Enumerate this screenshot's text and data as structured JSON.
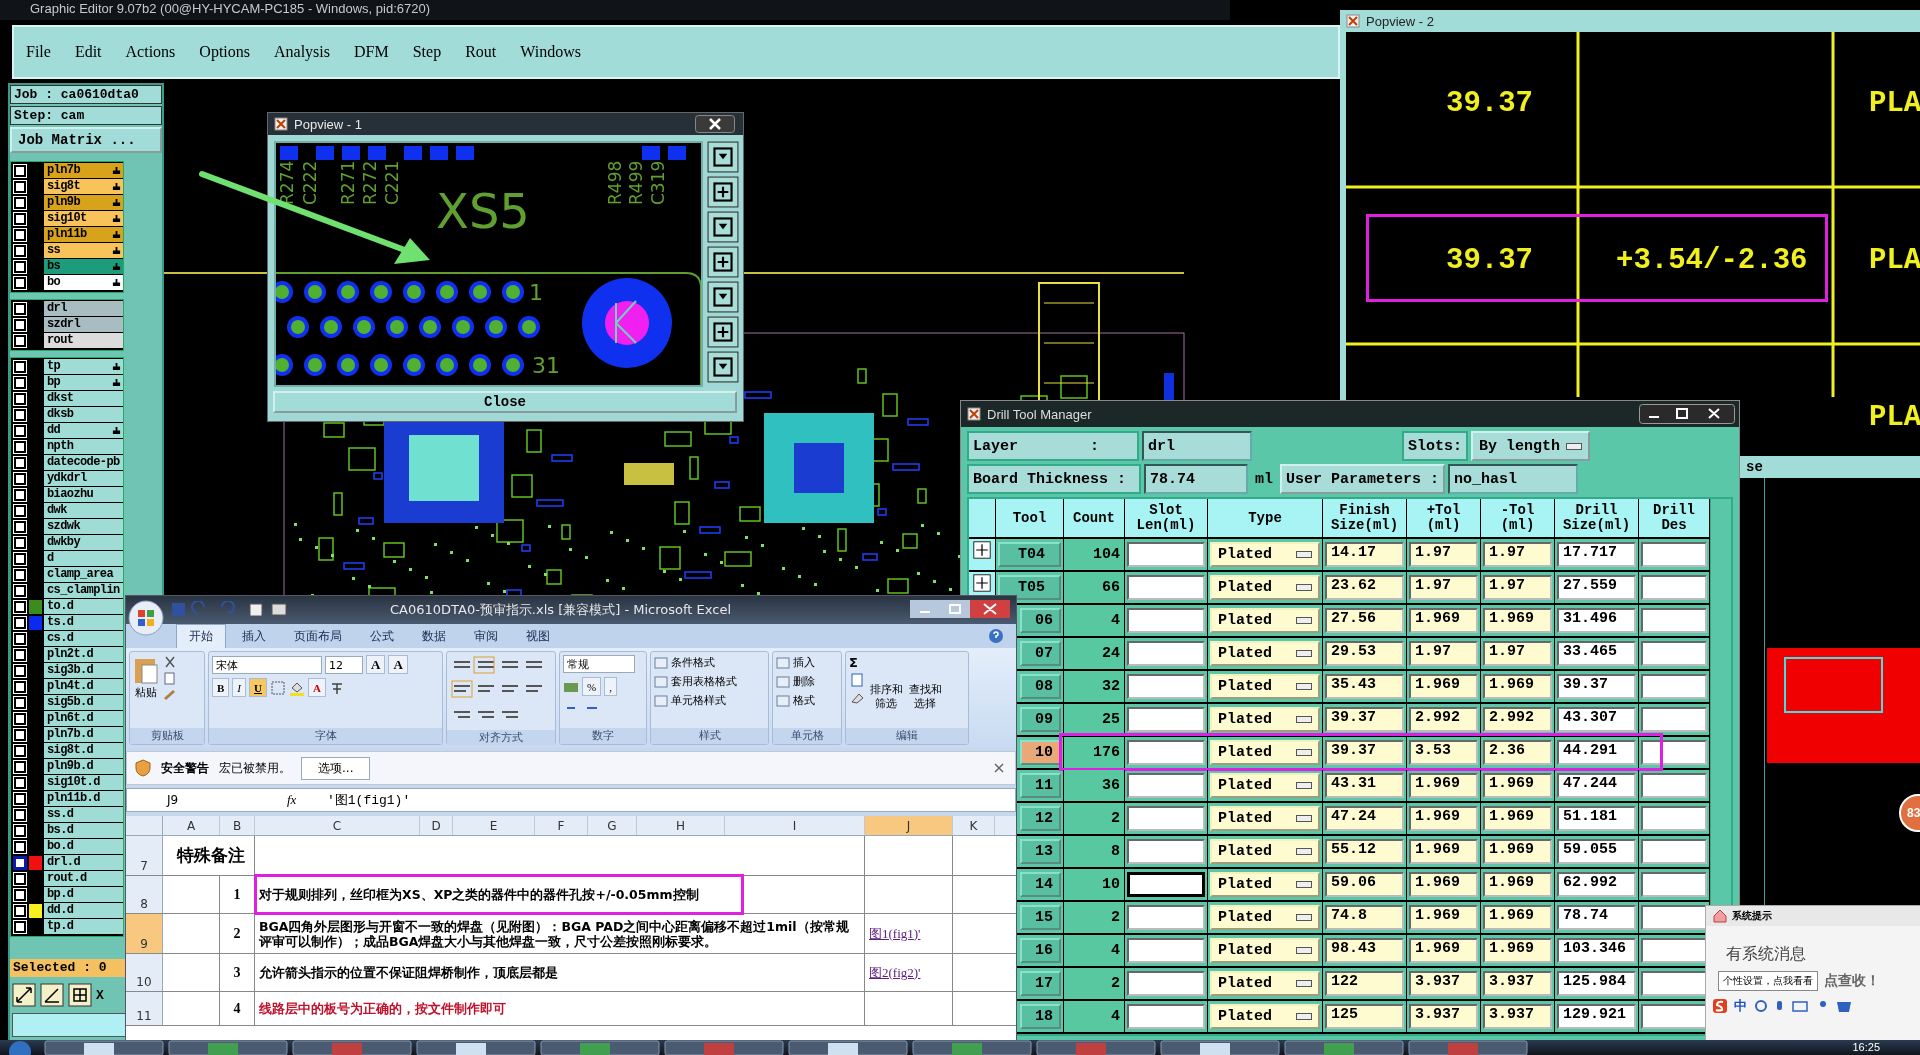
{
  "main_window": {
    "title": "Graphic Editor 9.07b2 (00@HY-HYCAM-PC185 - Windows, pid:6720)",
    "menu": [
      "File",
      "Edit",
      "Actions",
      "Options",
      "Analysis",
      "DFM",
      "Step",
      "Rout",
      "Windows"
    ]
  },
  "layer_panel": {
    "job": "Job : ca0610dta0",
    "step": "Step: cam",
    "matrix_button": "Job Matrix ...",
    "groups": [
      {
        "items": [
          {
            "name": "pln7b",
            "color": "#d9a21b",
            "pointer": true,
            "checked": false
          },
          {
            "name": "sig8t",
            "color": "#f7c35a",
            "pointer": true,
            "checked": false
          },
          {
            "name": "pln9b",
            "color": "#d9a21b",
            "pointer": true,
            "checked": false
          },
          {
            "name": "sig10t",
            "color": "#f7c35a",
            "pointer": true,
            "checked": false
          },
          {
            "name": "pln11b",
            "color": "#d9a21b",
            "pointer": true,
            "checked": false
          },
          {
            "name": "ss",
            "color": "#f7c35a",
            "pointer": true,
            "checked": false
          },
          {
            "name": "bs",
            "color": "#1d9c7c",
            "pointer": true,
            "checked": false
          },
          {
            "name": "bo",
            "color": "#ffffff",
            "pointer": true,
            "checked": false
          }
        ]
      },
      {
        "items": [
          {
            "name": "drl",
            "color": "#a9bcc2",
            "pointer": false,
            "checked": false
          },
          {
            "name": "szdrl",
            "color": "#a9bcc2",
            "pointer": false,
            "checked": false
          },
          {
            "name": "rout",
            "color": "#dcdcdc",
            "pointer": false,
            "checked": false
          }
        ]
      },
      {
        "items": [
          {
            "name": "tp",
            "color": "#9fdcd6",
            "pointer": true,
            "checked": false
          },
          {
            "name": "bp",
            "color": "#9fdcd6",
            "pointer": true,
            "checked": false
          },
          {
            "name": "dkst",
            "color": "#9fdcd6",
            "pointer": false,
            "checked": false
          },
          {
            "name": "dksb",
            "color": "#9fdcd6",
            "pointer": false,
            "checked": false
          },
          {
            "name": "dd",
            "color": "#9fdcd6",
            "pointer": true,
            "checked": false
          },
          {
            "name": "npth",
            "color": "#9fdcd6",
            "pointer": false,
            "checked": false
          },
          {
            "name": "datecode-pb",
            "color": "#9fdcd6",
            "pointer": false,
            "checked": false
          },
          {
            "name": "ydkdrl",
            "color": "#9fdcd6",
            "pointer": false,
            "checked": false
          },
          {
            "name": "biaozhu",
            "color": "#9fdcd6",
            "pointer": false,
            "checked": false
          },
          {
            "name": "dwk",
            "color": "#9fdcd6",
            "pointer": false,
            "checked": false
          },
          {
            "name": "szdwk",
            "color": "#9fdcd6",
            "pointer": false,
            "checked": false
          },
          {
            "name": "dwkby",
            "color": "#9fdcd6",
            "pointer": false,
            "checked": false
          },
          {
            "name": "d",
            "color": "#9fdcd6",
            "pointer": false,
            "checked": false
          },
          {
            "name": "clamp_area",
            "color": "#9fdcd6",
            "pointer": false,
            "checked": false
          },
          {
            "name": "cs_clamplin",
            "color": "#9fdcd6",
            "pointer": false,
            "checked": false
          },
          {
            "name": "to.d",
            "color": "#9fdcd6",
            "pointer": false,
            "checked": false,
            "swatch": {
              "color": "#3c8c1c"
            }
          },
          {
            "name": "ts.d",
            "color": "#9fdcd6",
            "pointer": false,
            "checked": false,
            "swatch": {
              "color": "#0a2af0"
            }
          },
          {
            "name": "cs.d",
            "color": "#9fdcd6",
            "pointer": false,
            "checked": false
          },
          {
            "name": "pln2t.d",
            "color": "#9fdcd6",
            "pointer": false,
            "checked": false
          },
          {
            "name": "sig3b.d",
            "color": "#9fdcd6",
            "pointer": false,
            "checked": false
          },
          {
            "name": "pln4t.d",
            "color": "#9fdcd6",
            "pointer": false,
            "checked": false
          },
          {
            "name": "sig5b.d",
            "color": "#9fdcd6",
            "pointer": false,
            "checked": false
          },
          {
            "name": "pln6t.d",
            "color": "#9fdcd6",
            "pointer": false,
            "checked": false
          },
          {
            "name": "pln7b.d",
            "color": "#9fdcd6",
            "pointer": false,
            "checked": false
          },
          {
            "name": "sig8t.d",
            "color": "#9fdcd6",
            "pointer": false,
            "checked": false
          },
          {
            "name": "pln9b.d",
            "color": "#9fdcd6",
            "pointer": false,
            "checked": false
          },
          {
            "name": "sig10t.d",
            "color": "#9fdcd6",
            "pointer": false,
            "checked": false
          },
          {
            "name": "pln11b.d",
            "color": "#9fdcd6",
            "pointer": false,
            "checked": false
          },
          {
            "name": "ss.d",
            "color": "#9fdcd6",
            "pointer": false,
            "checked": false
          },
          {
            "name": "bs.d",
            "color": "#9fdcd6",
            "pointer": false,
            "checked": false
          },
          {
            "name": "bo.d",
            "color": "#9fdcd6",
            "pointer": false,
            "checked": false
          },
          {
            "name": "drl.d",
            "color": "#9fdcd6",
            "pointer": false,
            "checked": false,
            "box": {
              "color": "#0a1ab0"
            },
            "swatch": {
              "color": "#f01010"
            }
          },
          {
            "name": "rout.d",
            "color": "#9fdcd6",
            "pointer": false,
            "checked": false
          },
          {
            "name": "bp.d",
            "color": "#9fdcd6",
            "pointer": false,
            "checked": false
          },
          {
            "name": "dd.d",
            "color": "#9fdcd6",
            "pointer": false,
            "checked": false,
            "swatch": {
              "color": "#f8f020"
            }
          },
          {
            "name": "tp.d",
            "color": "#9fdcd6",
            "pointer": false,
            "checked": false
          }
        ]
      }
    ],
    "selected_count": "Selected : 0",
    "coordinates": "X"
  },
  "popview_1": {
    "title": "Popview - 1",
    "reference": "XS5",
    "pins": [
      "1",
      "31"
    ],
    "components": [
      "R274",
      "C222",
      "R271",
      "R272",
      "C221",
      "R498",
      "R499",
      "C319"
    ],
    "close_button": "Close"
  },
  "popview_2": {
    "title": "Popview - 2",
    "rows": [
      {
        "finish": "39.37",
        "type": "PLA",
        "highlighted": false
      },
      {
        "finish": "39.37",
        "tolerance": "+3.54/-2.36",
        "type": "PLA",
        "highlighted": true
      },
      {
        "type": "PLA",
        "highlighted": false
      }
    ]
  },
  "side_window": {
    "title": "se",
    "badge": "83"
  },
  "drill_tool_manager": {
    "title": "Drill Tool Manager",
    "layer_label": "Layer        :",
    "layer": "drl",
    "slots_label": "Slots:",
    "slots": "By length",
    "thickness_label": "Board Thickness :",
    "thickness": "78.74",
    "thickness_unit": "ml",
    "user_params_label": "User Parameters :",
    "user_params": "no_hasl",
    "columns": [
      "Tool",
      "Count",
      "Slot\nLen(ml)",
      "Type",
      "Finish\nSize(ml)",
      "+Tol\n(ml)",
      "-Tol\n(ml)",
      "Drill\nSize(ml)",
      "Drill\nDes"
    ],
    "rows": [
      {
        "tool": "T04",
        "count": "104",
        "type": "Plated",
        "finish": "14.17",
        "plus_tol": "1.97",
        "minus_tol": "1.97",
        "drill_size": "17.717",
        "expandable": true,
        "selected": false,
        "highlighted": false,
        "focused": false
      },
      {
        "tool": "T05",
        "count": "66",
        "type": "Plated",
        "finish": "23.62",
        "plus_tol": "1.97",
        "minus_tol": "1.97",
        "drill_size": "27.559",
        "expandable": true,
        "selected": false,
        "highlighted": false,
        "focused": false
      },
      {
        "tool": "06",
        "count": "4",
        "type": "Plated",
        "finish": "27.56",
        "plus_tol": "1.969",
        "minus_tol": "1.969",
        "drill_size": "31.496",
        "selected": false,
        "highlighted": false,
        "focused": false
      },
      {
        "tool": "07",
        "count": "24",
        "type": "Plated",
        "finish": "29.53",
        "plus_tol": "1.97",
        "minus_tol": "1.97",
        "drill_size": "33.465",
        "selected": false,
        "highlighted": false,
        "focused": false
      },
      {
        "tool": "08",
        "count": "32",
        "type": "Plated",
        "finish": "35.43",
        "plus_tol": "1.969",
        "minus_tol": "1.969",
        "drill_size": "39.37",
        "selected": false,
        "highlighted": false,
        "focused": false
      },
      {
        "tool": "09",
        "count": "25",
        "type": "Plated",
        "finish": "39.37",
        "plus_tol": "2.992",
        "minus_tol": "2.992",
        "drill_size": "43.307",
        "selected": false,
        "highlighted": false,
        "focused": false
      },
      {
        "tool": "10",
        "count": "176",
        "type": "Plated",
        "finish": "39.37",
        "plus_tol": "3.53",
        "minus_tol": "2.36",
        "drill_size": "44.291",
        "selected": true,
        "highlighted": true,
        "focused": false
      },
      {
        "tool": "11",
        "count": "36",
        "type": "Plated",
        "finish": "43.31",
        "plus_tol": "1.969",
        "minus_tol": "1.969",
        "drill_size": "47.244",
        "selected": false,
        "highlighted": false,
        "focused": false
      },
      {
        "tool": "12",
        "count": "2",
        "type": "Plated",
        "finish": "47.24",
        "plus_tol": "1.969",
        "minus_tol": "1.969",
        "drill_size": "51.181",
        "selected": false,
        "highlighted": false,
        "focused": false
      },
      {
        "tool": "13",
        "count": "8",
        "type": "Plated",
        "finish": "55.12",
        "plus_tol": "1.969",
        "minus_tol": "1.969",
        "drill_size": "59.055",
        "selected": false,
        "highlighted": false,
        "focused": false
      },
      {
        "tool": "14",
        "count": "10",
        "type": "Plated",
        "finish": "59.06",
        "plus_tol": "1.969",
        "minus_tol": "1.969",
        "drill_size": "62.992",
        "selected": false,
        "highlighted": false,
        "focused": true
      },
      {
        "tool": "15",
        "count": "2",
        "type": "Plated",
        "finish": "74.8",
        "plus_tol": "1.969",
        "minus_tol": "1.969",
        "drill_size": "78.74",
        "selected": false,
        "highlighted": false,
        "focused": false
      },
      {
        "tool": "16",
        "count": "4",
        "type": "Plated",
        "finish": "98.43",
        "plus_tol": "1.969",
        "minus_tol": "1.969",
        "drill_size": "103.346",
        "selected": false,
        "highlighted": false,
        "focused": false
      },
      {
        "tool": "17",
        "count": "2",
        "type": "Plated",
        "finish": "122",
        "plus_tol": "3.937",
        "minus_tol": "3.937",
        "drill_size": "125.984",
        "selected": false,
        "highlighted": false,
        "focused": false
      },
      {
        "tool": "18",
        "count": "4",
        "type": "Plated",
        "finish": "125",
        "plus_tol": "3.937",
        "minus_tol": "3.937",
        "drill_size": "129.921",
        "selected": false,
        "highlighted": false,
        "focused": false
      }
    ]
  },
  "excel": {
    "title": "CA0610DTA0-预审指示.xls  [兼容模式] - Microsoft Excel",
    "tabs": [
      {
        "label": "开始",
        "selected": true
      },
      {
        "label": "插入",
        "selected": false
      },
      {
        "label": "页面布局",
        "selected": false
      },
      {
        "label": "公式",
        "selected": false
      },
      {
        "label": "数据",
        "selected": false
      },
      {
        "label": "审阅",
        "selected": false
      },
      {
        "label": "视图",
        "selected": false
      }
    ],
    "ribbon": [
      {
        "kind": "clipboard",
        "label": "剪贴板",
        "items": [
          "粘贴"
        ]
      },
      {
        "kind": "font",
        "label": "字体",
        "font": "宋体",
        "size": "12",
        "sizers": [
          "A",
          "A"
        ],
        "styles": [
          {
            "label": "B",
            "selected": false
          },
          {
            "label": "I",
            "selected": false
          },
          {
            "label": "U",
            "selected": true
          }
        ],
        "color_button": "A"
      },
      {
        "kind": "align",
        "label": "对齐方式"
      },
      {
        "kind": "number",
        "label": "数字",
        "format": "常规",
        "items": [
          "%",
          ","
        ]
      },
      {
        "kind": "list",
        "label": "样式",
        "items": [
          "条件格式",
          "套用表格格式",
          "单元格样式"
        ]
      },
      {
        "kind": "list",
        "label": "单元格",
        "items": [
          "插入",
          "删除",
          "格式"
        ]
      },
      {
        "kind": "edit",
        "label": "编辑",
        "sum": "Σ",
        "items": [
          "排序和筛选",
          "查找和选择"
        ]
      }
    ],
    "security": {
      "title": "安全警告",
      "message": "宏已被禁用。",
      "button": "选项..."
    },
    "name_box": "J9",
    "fx": "fx",
    "formula": "'图1(fig1)'",
    "columns": [
      {
        "label": "A",
        "selected": false
      },
      {
        "label": "B",
        "selected": false
      },
      {
        "label": "C",
        "selected": false
      },
      {
        "label": "D",
        "selected": false
      },
      {
        "label": "E",
        "selected": false
      },
      {
        "label": "F",
        "selected": false
      },
      {
        "label": "G",
        "selected": false
      },
      {
        "label": "H",
        "selected": false
      },
      {
        "label": "I",
        "selected": false
      },
      {
        "label": "J",
        "selected": true
      },
      {
        "label": "K",
        "selected": false
      }
    ],
    "rows": [
      {
        "num": "7",
        "kind": "heading",
        "heading": "特殊备注",
        "selected": false
      },
      {
        "num": "8",
        "kind": "item",
        "index": "1",
        "text": "对于规则排列，丝印框为XS、XP之类的器件中的器件孔按+/-0.05mm控制",
        "color": "#000000",
        "selected": false,
        "highlighted": true
      },
      {
        "num": "9",
        "kind": "item",
        "index": "2",
        "text": "BGA四角外层图形与开窗不一致的焊盘（见附图）：BGA PAD之间中心距离偏移不超过1mil（按常规评审可以制作）；成品BGA焊盘大小与其他焊盘一致，尺寸公差按照刚标要求。",
        "link": "图1(fig1)'",
        "color": "#000000",
        "selected": true,
        "highlighted": false
      },
      {
        "num": "10",
        "kind": "item",
        "index": "3",
        "text": "允许箭头指示的位置不保证阻焊桥制作，顶底层都是",
        "link": "图2(fig2)'",
        "color": "#000000",
        "selected": false,
        "highlighted": false
      },
      {
        "num": "11",
        "kind": "item",
        "index": "4",
        "text": "线路层中的板号为正确的，按文件制作即可",
        "color": "#c0102a",
        "selected": false,
        "highlighted": false
      }
    ]
  },
  "notification": {
    "title": "系统提示",
    "message": "有系统消息",
    "tooltip": "个性设置，点我看看",
    "action": "点查收！",
    "ime": "中"
  },
  "taskbar": {
    "clock": "16:25"
  }
}
